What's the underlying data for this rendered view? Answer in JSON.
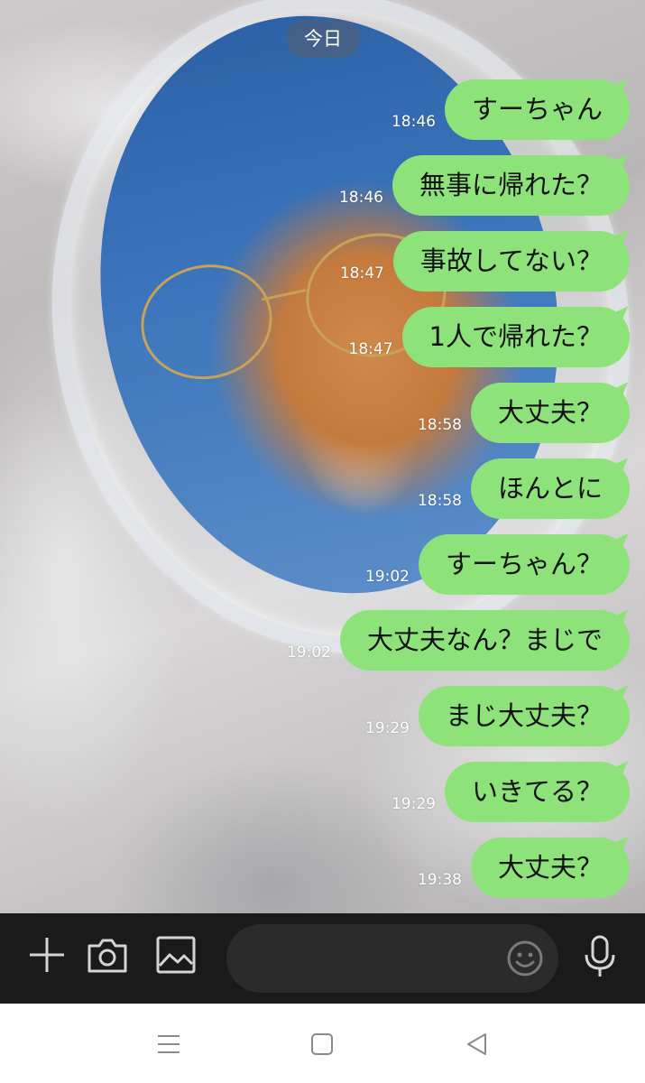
{
  "chat": {
    "date_label": "今日",
    "messages": [
      {
        "time": "18:46",
        "text": "すーちゃん"
      },
      {
        "time": "18:46",
        "text": "無事に帰れた？"
      },
      {
        "time": "18:47",
        "text": "事故してない？"
      },
      {
        "time": "18:47",
        "text": "1人で帰れた？"
      },
      {
        "time": "18:58",
        "text": "大丈夫？"
      },
      {
        "time": "18:58",
        "text": "ほんとに"
      },
      {
        "time": "19:02",
        "text": "すーちゃん？"
      },
      {
        "time": "19:02",
        "text": "大丈夫なん？まじで"
      },
      {
        "time": "19:29",
        "text": "まじ大丈夫？"
      },
      {
        "time": "19:29",
        "text": "いきてる？"
      },
      {
        "time": "19:38",
        "text": "大丈夫？"
      }
    ]
  },
  "input_bar": {
    "icons": [
      "plus-icon",
      "camera-icon",
      "image-icon",
      "emoji-icon",
      "microphone-icon"
    ],
    "message_value": ""
  },
  "nav_bar": {
    "icons": [
      "menu-icon",
      "home-icon",
      "back-icon"
    ]
  },
  "colors": {
    "bubble": "#8de37a",
    "input_bar": "#1a1a1a",
    "nav_bar": "#ffffff"
  }
}
